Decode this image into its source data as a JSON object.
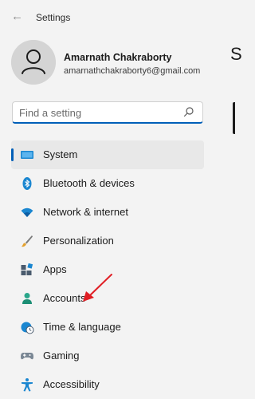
{
  "window": {
    "title": "Settings",
    "back_icon": "back-arrow-icon"
  },
  "profile": {
    "name": "Amarnath Chakraborty",
    "email": "amarnathchakraborty6@gmail.com",
    "avatar_icon": "person-icon"
  },
  "search": {
    "placeholder": "Find a setting",
    "value": "",
    "icon": "search-icon"
  },
  "page_heading_partial": "S",
  "nav": {
    "items": [
      {
        "label": "System",
        "icon": "monitor-icon",
        "selected": true
      },
      {
        "label": "Bluetooth & devices",
        "icon": "bluetooth-icon",
        "selected": false
      },
      {
        "label": "Network & internet",
        "icon": "wifi-icon",
        "selected": false
      },
      {
        "label": "Personalization",
        "icon": "brush-icon",
        "selected": false
      },
      {
        "label": "Apps",
        "icon": "apps-icon",
        "selected": false
      },
      {
        "label": "Accounts",
        "icon": "account-icon",
        "selected": false
      },
      {
        "label": "Time & language",
        "icon": "globe-clock-icon",
        "selected": false
      },
      {
        "label": "Gaming",
        "icon": "gamepad-icon",
        "selected": false
      },
      {
        "label": "Accessibility",
        "icon": "accessibility-icon",
        "selected": false
      }
    ]
  },
  "colors": {
    "accent": "#005fb8",
    "background": "#f3f3f3",
    "selected_item": "#e8e8e8",
    "annotation_arrow": "#e01e24"
  }
}
